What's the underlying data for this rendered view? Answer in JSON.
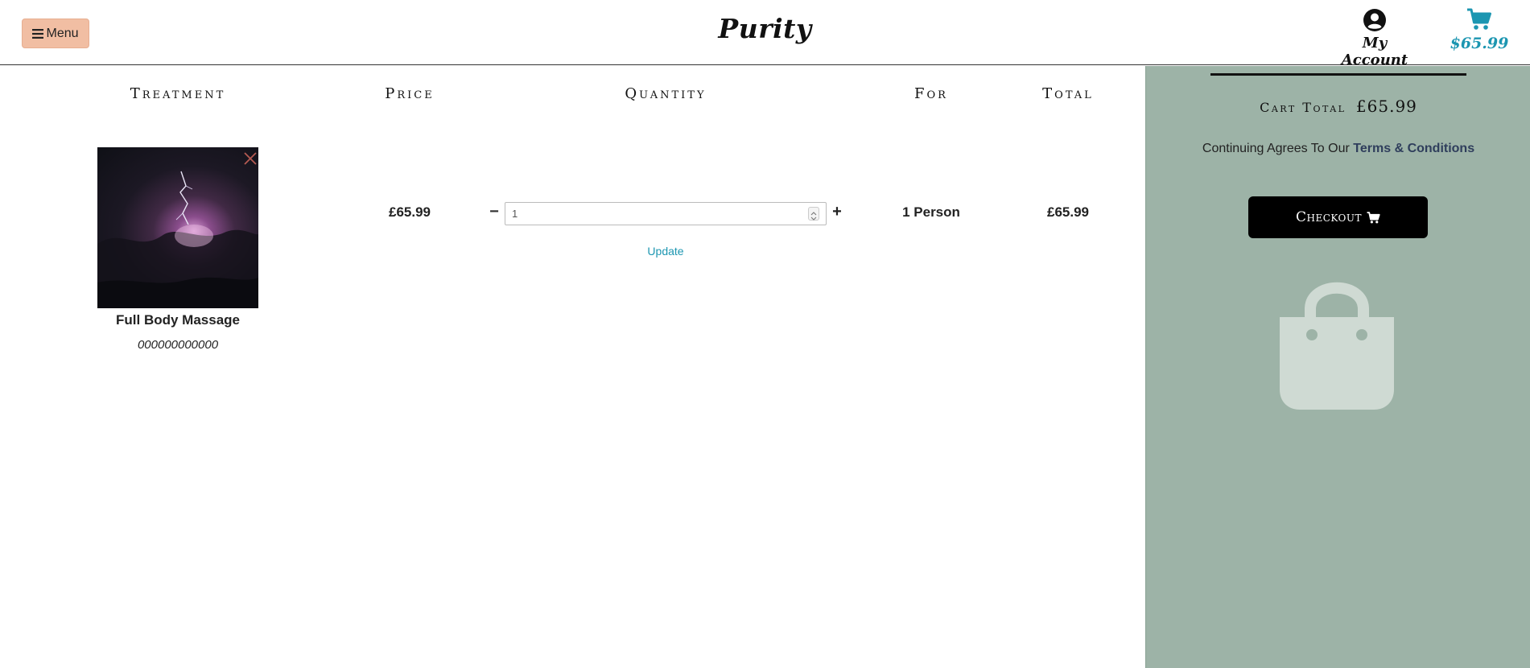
{
  "header": {
    "menu_label": "Menu",
    "logo": "Purity",
    "account_label": "My Account",
    "cart_amount": "$65.99"
  },
  "table": {
    "headers": [
      "Treatment",
      "Price",
      "Quantity",
      "For",
      "Total"
    ],
    "rows": [
      {
        "name": "Full Body Massage",
        "sku": "000000000000",
        "price": "£65.99",
        "quantity": "1",
        "for": "1 Person",
        "total": "£65.99"
      }
    ],
    "update_label": "Update"
  },
  "sidebar": {
    "cart_total_label": "Cart Total",
    "cart_total_value": "£65.99",
    "terms_prefix": "Continuing Agrees To Our",
    "terms_link": "Terms & Conditions",
    "checkout_label": "Checkout"
  },
  "colors": {
    "menu_button": "#f1bea3",
    "accent": "#1c96b1",
    "sidebar": "#9db3a7",
    "checkout": "#000000"
  }
}
